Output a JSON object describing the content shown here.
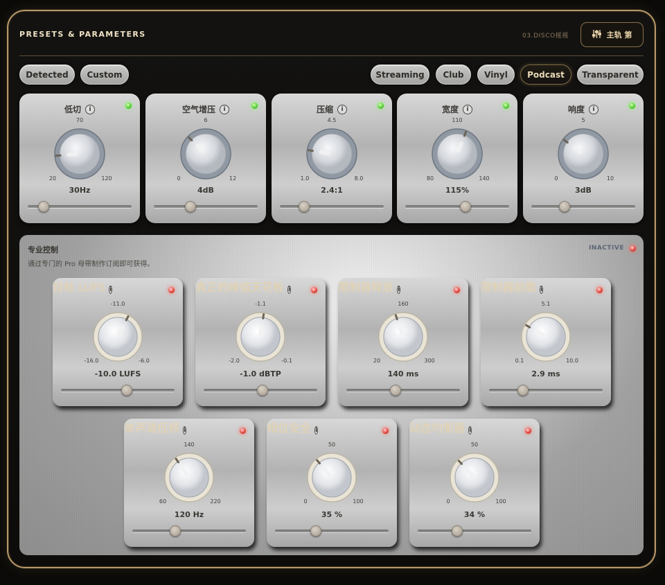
{
  "header": {
    "title": "PRESETS & PARAMETERS",
    "track": "03.DISCO摇摇",
    "button_label": "主轨 第"
  },
  "presets": {
    "left": [
      "Detected",
      "Custom"
    ],
    "right": [
      "Streaming",
      "Club",
      "Vinyl",
      "Podcast",
      "Transparent"
    ],
    "active": "Podcast"
  },
  "params": [
    {
      "label": "低切",
      "min": "20",
      "mid": "70",
      "max": "120",
      "value": "30Hz",
      "fraction": 0.15,
      "slider": 0.15
    },
    {
      "label": "空气增压",
      "min": "0",
      "mid": "6",
      "max": "12",
      "value": "4dB",
      "fraction": 0.33,
      "slider": 0.35
    },
    {
      "label": "压缩",
      "min": "1.0",
      "mid": "4.5",
      "max": "8.0",
      "value": "2.4:1",
      "fraction": 0.2,
      "slider": 0.23
    },
    {
      "label": "宽度",
      "min": "80",
      "mid": "110",
      "max": "140",
      "value": "115%",
      "fraction": 0.58,
      "slider": 0.58
    },
    {
      "label": "响度",
      "min": "0",
      "mid": "5",
      "max": "10",
      "value": "3dB",
      "fraction": 0.3,
      "slider": 0.32
    }
  ],
  "pro": {
    "title": "专业控制",
    "subtitle": "通过专门的 Pro 母带制作订阅即可获得。",
    "status": "INACTIVE",
    "controls": [
      {
        "label": "目标 LUFS",
        "min": "-16.0",
        "mid": "-11.0",
        "max": "-6.0",
        "value": "-10.0 LUFS",
        "fraction": 0.6,
        "slider": 0.58
      },
      {
        "label": "真正的峰值天花板",
        "min": "-2.0",
        "mid": "-1.1",
        "max": "-0.1",
        "value": "-1.0 dBTP",
        "fraction": 0.53,
        "slider": 0.52
      },
      {
        "label": "限制器释放",
        "min": "20",
        "mid": "160",
        "max": "300",
        "value": "140 ms",
        "fraction": 0.43,
        "slider": 0.43
      },
      {
        "label": "限制器前瞻",
        "min": "0.1",
        "mid": "5.1",
        "max": "10.0",
        "value": "2.9 ms",
        "fraction": 0.28,
        "slider": 0.3
      },
      {
        "label": "单声道低频",
        "min": "60",
        "mid": "140",
        "max": "220",
        "value": "120 Hz",
        "fraction": 0.37,
        "slider": 0.38
      },
      {
        "label": "相位安全",
        "min": "0",
        "mid": "50",
        "max": "100",
        "value": "35 %",
        "fraction": 0.35,
        "slider": 0.36
      },
      {
        "label": "动态均衡器",
        "min": "0",
        "mid": "50",
        "max": "100",
        "value": "34 %",
        "fraction": 0.34,
        "slider": 0.35
      }
    ]
  },
  "colors": {
    "accent": "#b69868",
    "led_on": "#59d13a",
    "led_off": "#e5483f"
  }
}
